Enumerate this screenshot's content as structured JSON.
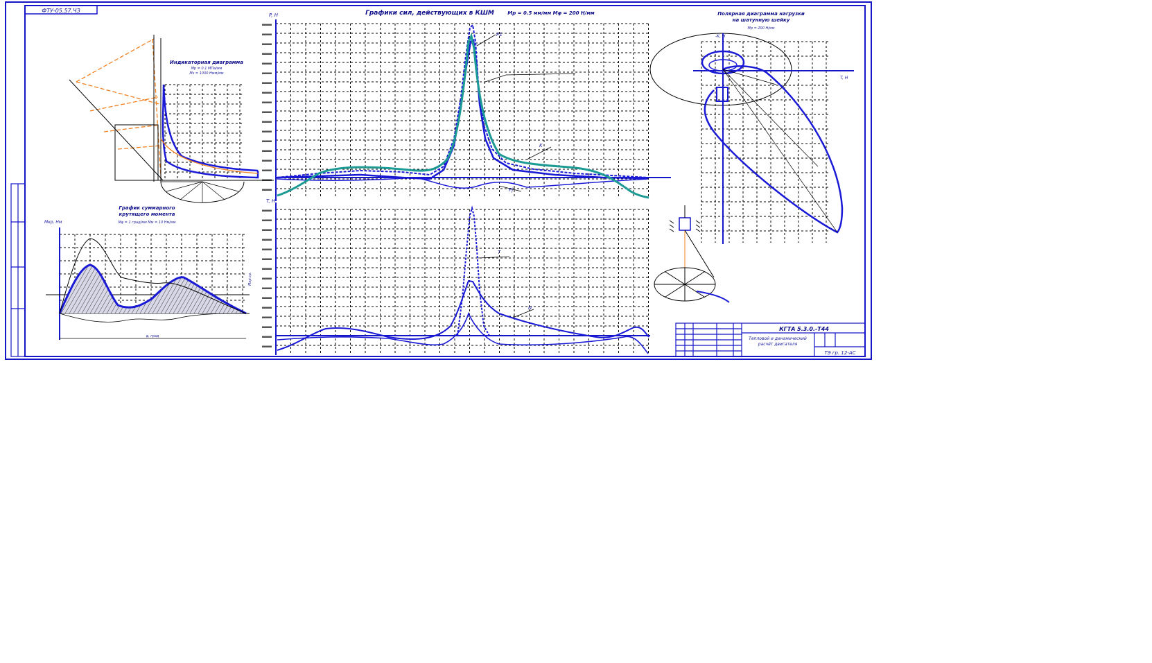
{
  "drawing": {
    "stamp_code": "ФТУ-05.57.ЧЗ",
    "title_force_graph": "Графики сил, действующих в КШМ",
    "title_force_scale": "Mp = 0.5 мм/мм   Mφ = 200 Н/мм",
    "title_indicator": "Индикаторная диаграмма",
    "indicator_scale_1": "Mp = 0.1 МПа/мм",
    "indicator_scale_2": "Ms = 1000 Нмм/мм",
    "title_torque_1": "График суммарного",
    "title_torque_2": "крутящего момента",
    "torque_scale": "Mφ = 1 град/мм    Mм = 10 Нм/мм",
    "title_polar_1": "Полярная диаграмма нагрузки",
    "title_polar_2": "на шатунную шейку",
    "polar_scale": "Mp = 200 Н/мм",
    "title_block_code": "КГТА 5.3.0.-Т44",
    "title_block_name_1": "Тепловой и динамический",
    "title_block_name_2": "расчёт двигателя",
    "title_block_group": "ТЭ гр. 12-АС"
  },
  "axes": {
    "force_top_y": "P, Н",
    "force_bottom_y": "T, Н",
    "torque_y": "Mкр, Нм",
    "torque_mean": "Mкр.ср.",
    "polar_x": "T, Н",
    "polar_y": "-K, Н",
    "angle_axis": "φ, град"
  },
  "curve_labels": {
    "p_sum": "PΣ",
    "p_j": "Pj",
    "p_g": "Pг",
    "t": "T",
    "k": "K",
    "n": "N"
  },
  "colors": {
    "paper": "#ffffff",
    "frame": "#1515c8",
    "curve_main": "#1a1ad6",
    "curve_teal": "#1c9a94",
    "construction": "#f08020",
    "grid": "#000000"
  }
}
